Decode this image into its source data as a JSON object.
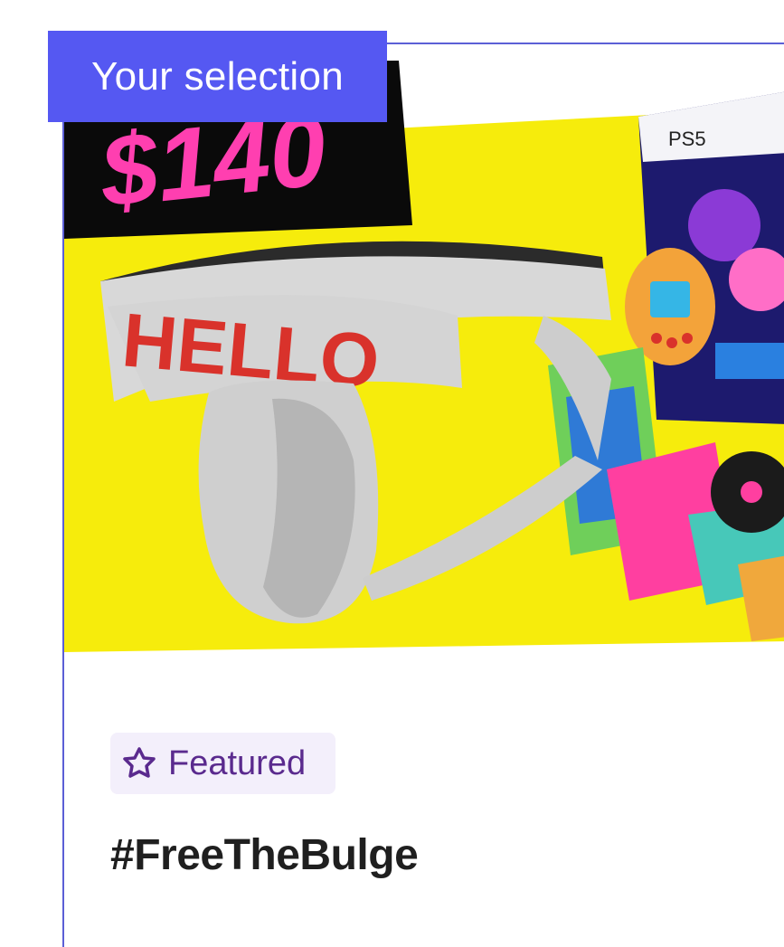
{
  "badge": {
    "text": "Your selection"
  },
  "product": {
    "image_price_text": "$140",
    "image_band_text": "HELLO",
    "image_console_text": "PS5",
    "featured_label": "Featured",
    "title": "#FreeTheBulge"
  },
  "colors": {
    "accent": "#5558f2",
    "card_border": "#5b5fd6",
    "featured_bg": "#f3effb",
    "featured_text": "#5a2a8e",
    "image_yellow": "#f6ec0c",
    "price_pink": "#ff3fb0",
    "band_red": "#d9322b"
  },
  "icons": {
    "featured": "flower-star-icon"
  }
}
